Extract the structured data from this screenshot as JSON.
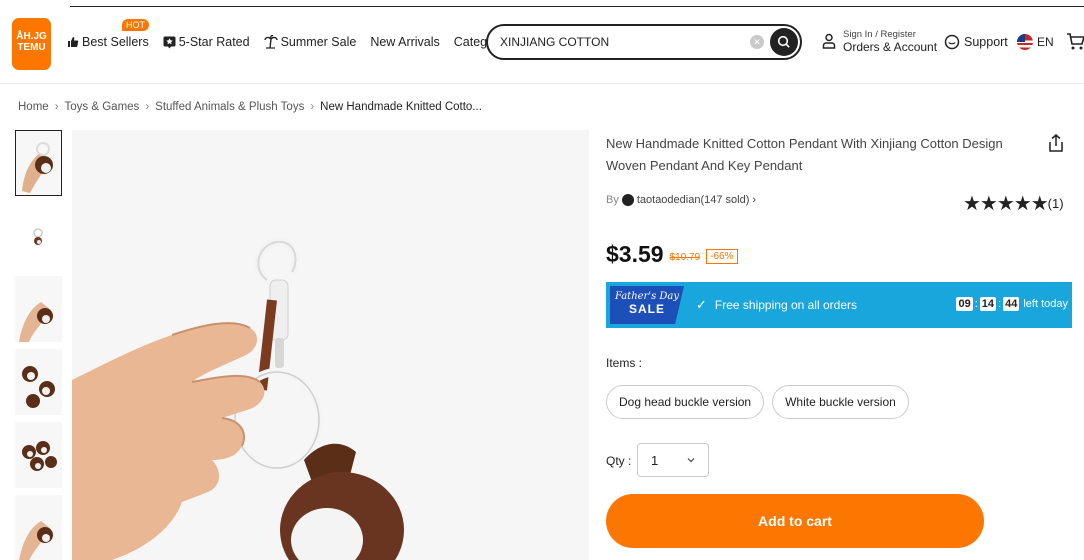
{
  "header": {
    "logo_line1": "ÅH.JG",
    "logo_line2": "TEMU",
    "nav": [
      {
        "label": "Best Sellers",
        "badge": "HOT",
        "icon": "thumbs-up-icon"
      },
      {
        "label": "5-Star Rated",
        "icon": "star-badge-icon"
      },
      {
        "label": "Summer Sale",
        "icon": "palm-tree-icon"
      },
      {
        "label": "New Arrivals"
      },
      {
        "label": "Categories",
        "icon": "chevron-down-icon"
      }
    ],
    "search": {
      "value": "XINJIANG COTTON"
    },
    "account": {
      "small": "Sign In / Register",
      "main": "Orders & Account"
    },
    "support": "Support",
    "language": "EN"
  },
  "breadcrumb": [
    "Home",
    "Toys & Games",
    "Stuffed Animals & Plush Toys",
    "New Handmade Knitted Cotto..."
  ],
  "product": {
    "title": "New Handmade Knitted Cotton Pendant With Xinjiang Cotton Design Woven Pendant And Key Pendant",
    "store_prefix": "By",
    "store_name": "taotaodedian(147 sold) ›",
    "stars": "★★★★★",
    "rating_count": "(1)",
    "price": "$3.59",
    "original_price": "$10.79",
    "discount": "-66%",
    "promo": {
      "badge_line1": "Father's Day",
      "badge_line2": "SALE",
      "check": "✓",
      "text": "Free shipping on all orders",
      "countdown": [
        "09",
        "14",
        "44"
      ],
      "countdown_label": "left today"
    },
    "items_label": "Items :",
    "options": [
      "Dog head buckle version",
      "White buckle version"
    ],
    "qty_label": "Qty :",
    "qty_value": "1",
    "add_to_cart": "Add to cart"
  },
  "colors": {
    "brand": "#fb7701",
    "promo_bg": "#18a6dc",
    "promo_badge": "#1d4fb8"
  }
}
